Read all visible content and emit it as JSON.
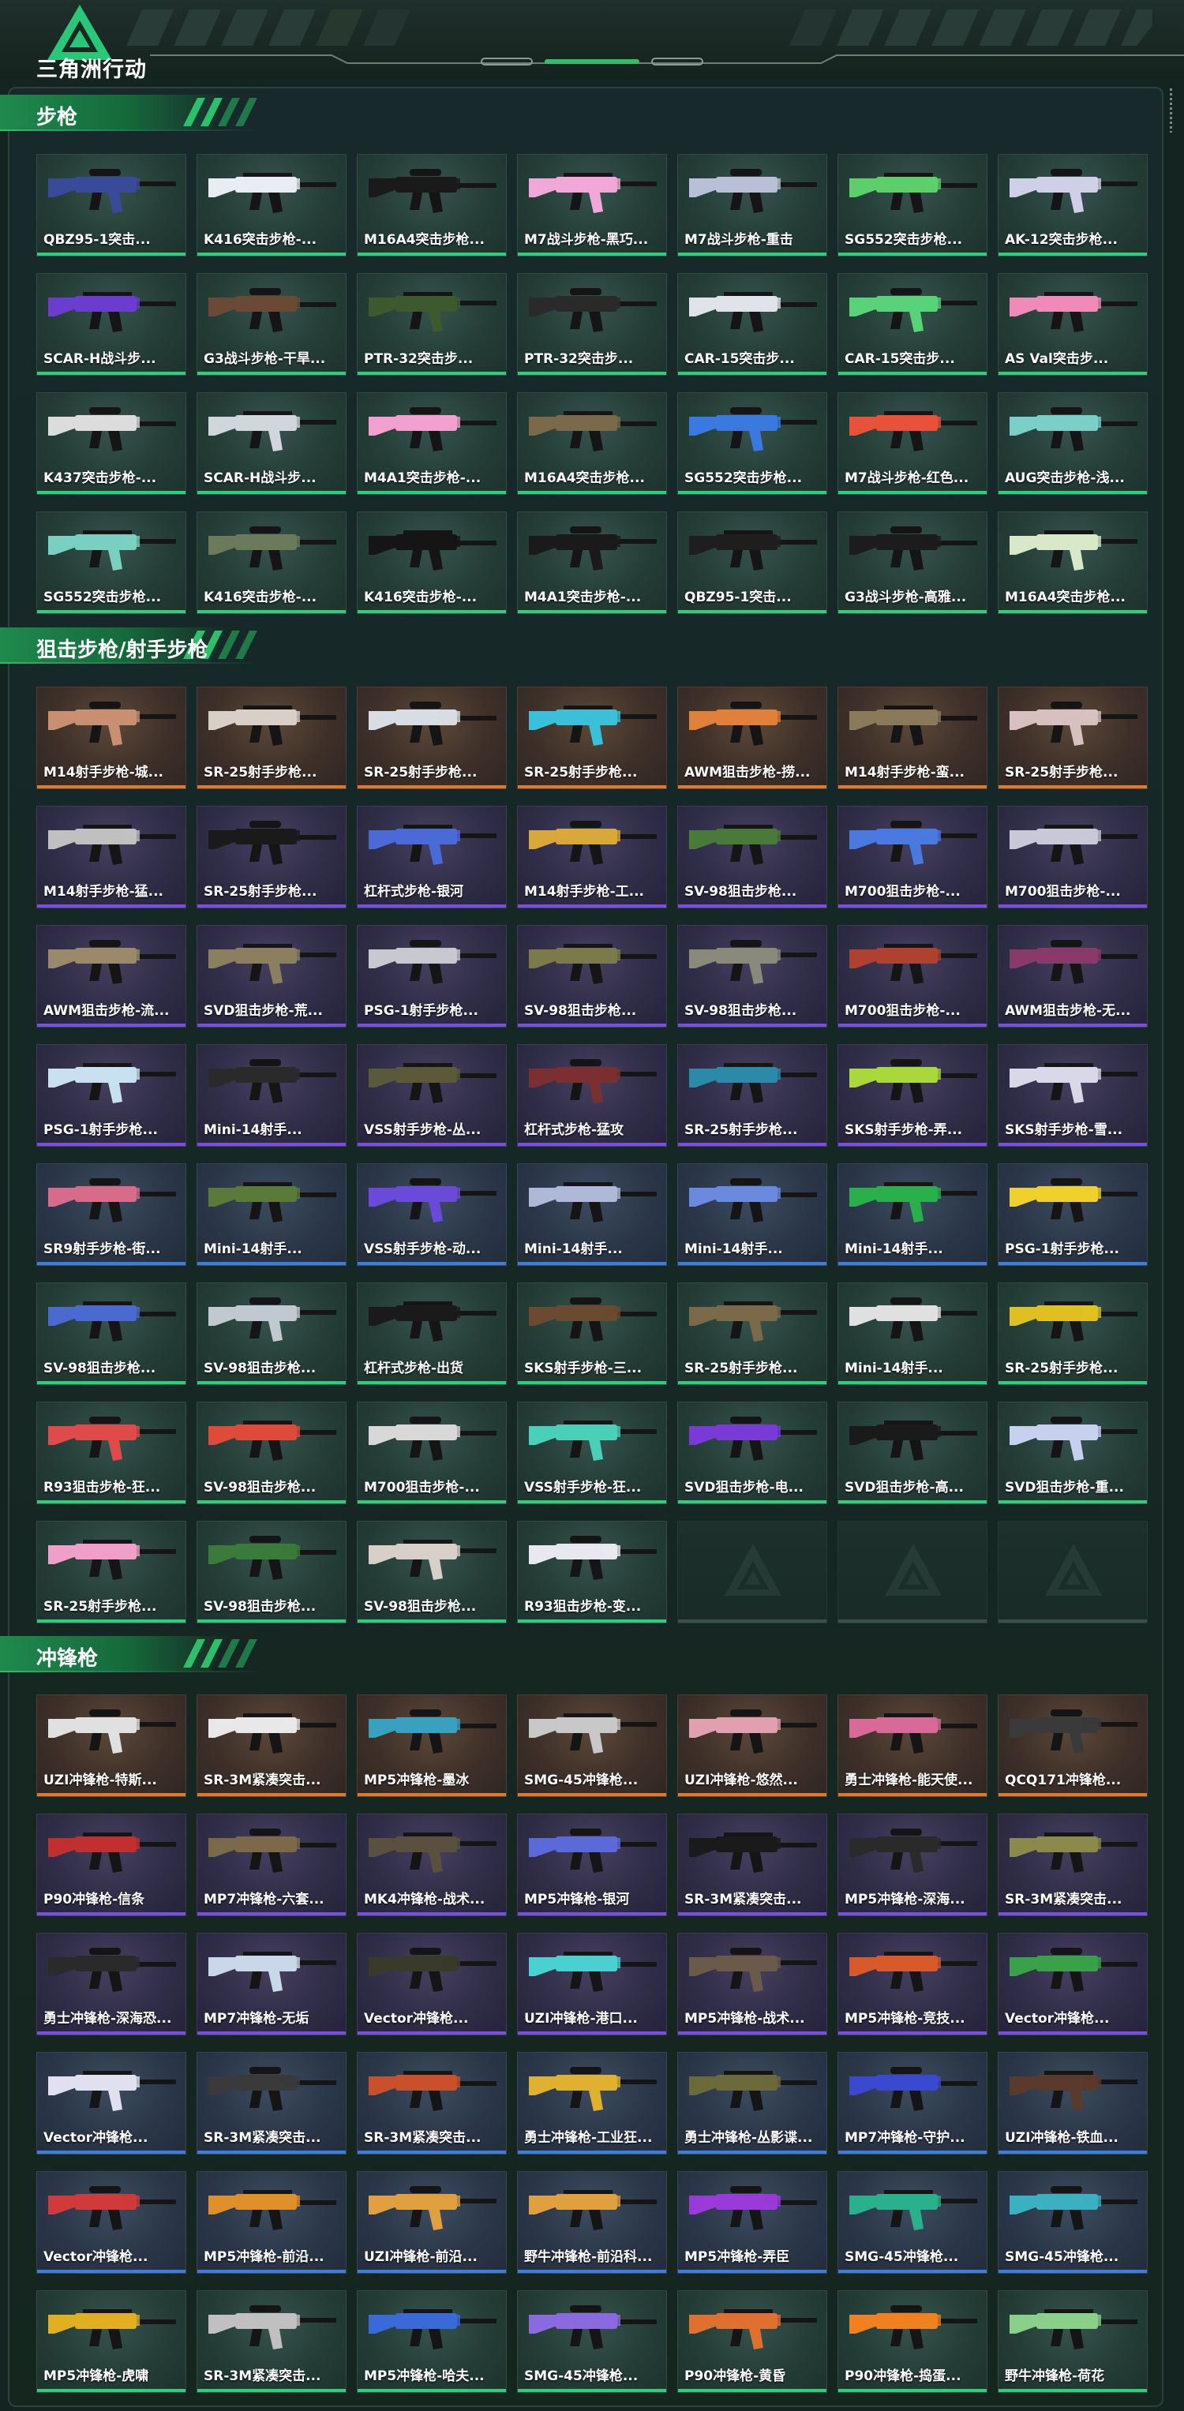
{
  "header": {
    "logo_text": "三角洲行动"
  },
  "sections": [
    {
      "title": "步枪",
      "cards": [
        {
          "label": "QBZ95-1突击...",
          "rarity": "green",
          "gun_color": "#3a4a9a"
        },
        {
          "label": "K416突击步枪-...",
          "rarity": "green",
          "gun_color": "#e8ecf5"
        },
        {
          "label": "M16A4突击步枪...",
          "rarity": "green",
          "gun_color": "#1a1a1a"
        },
        {
          "label": "M7战斗步枪-黑巧...",
          "rarity": "green",
          "gun_color": "#f0a8d8"
        },
        {
          "label": "M7战斗步枪-重击",
          "rarity": "green",
          "gun_color": "#b9bfd6"
        },
        {
          "label": "SG552突击步枪...",
          "rarity": "green",
          "gun_color": "#5ccf6a"
        },
        {
          "label": "AK-12突击步枪...",
          "rarity": "green",
          "gun_color": "#cfcfe8"
        },
        {
          "label": "SCAR-H战斗步...",
          "rarity": "green",
          "gun_color": "#6a3ccf"
        },
        {
          "label": "G3战斗步枪-干旱...",
          "rarity": "green",
          "gun_color": "#6b4a35"
        },
        {
          "label": "PTR-32突击步...",
          "rarity": "green",
          "gun_color": "#3c5a2e"
        },
        {
          "label": "PTR-32突击步...",
          "rarity": "green",
          "gun_color": "#2a2a2a"
        },
        {
          "label": "CAR-15突击步...",
          "rarity": "green",
          "gun_color": "#dfe3ea"
        },
        {
          "label": "CAR-15突击步...",
          "rarity": "green",
          "gun_color": "#58d37a"
        },
        {
          "label": "AS Val突击步...",
          "rarity": "green",
          "gun_color": "#f08ab8"
        },
        {
          "label": "K437突击步枪-...",
          "rarity": "green",
          "gun_color": "#dcdcdc"
        },
        {
          "label": "SCAR-H战斗步...",
          "rarity": "green",
          "gun_color": "#cfd6dc"
        },
        {
          "label": "M4A1突击步枪-...",
          "rarity": "green",
          "gun_color": "#f2a0d0"
        },
        {
          "label": "M16A4突击步枪...",
          "rarity": "green",
          "gun_color": "#7a6a4a"
        },
        {
          "label": "SG552突击步枪...",
          "rarity": "green",
          "gun_color": "#3a7ae0"
        },
        {
          "label": "M7战斗步枪-红色...",
          "rarity": "green",
          "gun_color": "#e8523a"
        },
        {
          "label": "AUG突击步枪-浅...",
          "rarity": "green",
          "gun_color": "#7ad0c8"
        },
        {
          "label": "SG552突击步枪...",
          "rarity": "green",
          "gun_color": "#7ad0c0"
        },
        {
          "label": "K416突击步枪-...",
          "rarity": "green",
          "gun_color": "#6a7a5a"
        },
        {
          "label": "K416突击步枪-...",
          "rarity": "green",
          "gun_color": "#151515"
        },
        {
          "label": "M4A1突击步枪-...",
          "rarity": "green",
          "gun_color": "#1a1a1a"
        },
        {
          "label": "QBZ95-1突击...",
          "rarity": "green",
          "gun_color": "#1e1e1e"
        },
        {
          "label": "G3战斗步枪-高雅...",
          "rarity": "green",
          "gun_color": "#1c1c1c"
        },
        {
          "label": "M16A4突击步枪...",
          "rarity": "green",
          "gun_color": "#d8e8c8"
        }
      ]
    },
    {
      "title": "狙击步枪/射手步枪",
      "cards": [
        {
          "label": "M14射手步枪-城...",
          "rarity": "orange",
          "gun_color": "#c89070"
        },
        {
          "label": "SR-25射手步枪...",
          "rarity": "orange",
          "gun_color": "#d8d0c8"
        },
        {
          "label": "SR-25射手步枪...",
          "rarity": "orange",
          "gun_color": "#d8dde3"
        },
        {
          "label": "SR-25射手步枪...",
          "rarity": "orange",
          "gun_color": "#3ac0d8"
        },
        {
          "label": "AWM狙击步枪-捞...",
          "rarity": "orange",
          "gun_color": "#e0803a"
        },
        {
          "label": "M14射手步枪-蛮...",
          "rarity": "orange",
          "gun_color": "#8a7a5a"
        },
        {
          "label": "SR-25射手步枪...",
          "rarity": "orange",
          "gun_color": "#d8c0c0"
        },
        {
          "label": "M14射手步枪-猛...",
          "rarity": "purple",
          "gun_color": "#c0c0c0"
        },
        {
          "label": "SR-25射手步枪...",
          "rarity": "purple",
          "gun_color": "#1a1a1a"
        },
        {
          "label": "杠杆式步枪-银河",
          "rarity": "purple",
          "gun_color": "#4a6ad8"
        },
        {
          "label": "M14射手步枪-工...",
          "rarity": "purple",
          "gun_color": "#d8a83a"
        },
        {
          "label": "SV-98狙击步枪...",
          "rarity": "purple",
          "gun_color": "#4a7a3a"
        },
        {
          "label": "M700狙击步枪-...",
          "rarity": "purple",
          "gun_color": "#4a7ae0"
        },
        {
          "label": "M700狙击步枪-...",
          "rarity": "purple",
          "gun_color": "#c8c8d8"
        },
        {
          "label": "AWM狙击步枪-流...",
          "rarity": "purple",
          "gun_color": "#9a8a6a"
        },
        {
          "label": "SVD狙击步枪-荒...",
          "rarity": "purple",
          "gun_color": "#8a8060"
        },
        {
          "label": "PSG-1射手步枪...",
          "rarity": "purple",
          "gun_color": "#c8c8d0"
        },
        {
          "label": "SV-98狙击步枪...",
          "rarity": "purple",
          "gun_color": "#7a7a4a"
        },
        {
          "label": "SV-98狙击步枪...",
          "rarity": "purple",
          "gun_color": "#8a8a7a"
        },
        {
          "label": "M700狙击步枪-...",
          "rarity": "purple",
          "gun_color": "#b04030"
        },
        {
          "label": "AWM狙击步枪-无...",
          "rarity": "purple",
          "gun_color": "#8a3a6a"
        },
        {
          "label": "PSG-1射手步枪...",
          "rarity": "purple",
          "gun_color": "#c8e0f0"
        },
        {
          "label": "Mini-14射手...",
          "rarity": "purple",
          "gun_color": "#2a2a2a"
        },
        {
          "label": "VSS射手步枪-丛...",
          "rarity": "purple",
          "gun_color": "#5a5a3a"
        },
        {
          "label": "杠杆式步枪-猛攻",
          "rarity": "purple",
          "gun_color": "#7a3030"
        },
        {
          "label": "SR-25射手步枪...",
          "rarity": "purple",
          "gun_color": "#2a8aa8"
        },
        {
          "label": "SKS射手步枪-弄...",
          "rarity": "purple",
          "gun_color": "#a8d83a"
        },
        {
          "label": "SKS射手步枪-雪...",
          "rarity": "purple",
          "gun_color": "#d8d8e8"
        },
        {
          "label": "SR9射手步枪-街...",
          "rarity": "blue",
          "gun_color": "#d86a8a"
        },
        {
          "label": "Mini-14射手...",
          "rarity": "blue",
          "gun_color": "#5a7a3a"
        },
        {
          "label": "VSS射手步枪-动...",
          "rarity": "blue",
          "gun_color": "#6a4ad8"
        },
        {
          "label": "Mini-14射手...",
          "rarity": "blue",
          "gun_color": "#b0b8d8"
        },
        {
          "label": "Mini-14射手...",
          "rarity": "blue",
          "gun_color": "#6a8ae0"
        },
        {
          "label": "Mini-14射手...",
          "rarity": "blue",
          "gun_color": "#2ab04a"
        },
        {
          "label": "PSG-1射手步枪...",
          "rarity": "blue",
          "gun_color": "#f0d02a"
        },
        {
          "label": "SV-98狙击步枪...",
          "rarity": "green",
          "gun_color": "#4a6ad0"
        },
        {
          "label": "SV-98狙击步枪...",
          "rarity": "green",
          "gun_color": "#c0c8d0"
        },
        {
          "label": "杠杆式步枪-出货",
          "rarity": "green",
          "gun_color": "#1a1a1a"
        },
        {
          "label": "SKS射手步枪-三...",
          "rarity": "green",
          "gun_color": "#6a4a30"
        },
        {
          "label": "SR-25射手步枪...",
          "rarity": "green",
          "gun_color": "#7a6a4a"
        },
        {
          "label": "Mini-14射手...",
          "rarity": "green",
          "gun_color": "#e0e0e0"
        },
        {
          "label": "SR-25射手步枪...",
          "rarity": "green",
          "gun_color": "#e0c020"
        },
        {
          "label": "R93狙击步枪-狂...",
          "rarity": "green",
          "gun_color": "#e04a4a"
        },
        {
          "label": "SV-98狙击步枪...",
          "rarity": "green",
          "gun_color": "#e04a3a"
        },
        {
          "label": "M700狙击步枪-...",
          "rarity": "green",
          "gun_color": "#d8d8d8"
        },
        {
          "label": "VSS射手步枪-狂...",
          "rarity": "green",
          "gun_color": "#4ad0b8"
        },
        {
          "label": "SVD狙击步枪-电...",
          "rarity": "green",
          "gun_color": "#7a3ad8"
        },
        {
          "label": "SVD狙击步枪-高...",
          "rarity": "green",
          "gun_color": "#1a1a1a"
        },
        {
          "label": "SVD狙击步枪-重...",
          "rarity": "green",
          "gun_color": "#c8d0f0"
        },
        {
          "label": "SR-25射手步枪...",
          "rarity": "green",
          "gun_color": "#f0a0c8"
        },
        {
          "label": "SV-98狙击步枪...",
          "rarity": "green",
          "gun_color": "#3a7a3a"
        },
        {
          "label": "SV-98狙击步枪...",
          "rarity": "green",
          "gun_color": "#d8d0c8"
        },
        {
          "label": "R93狙击步枪-变...",
          "rarity": "green",
          "gun_color": "#e8e8f0"
        },
        {
          "label": "",
          "rarity": "empty",
          "gun_color": ""
        },
        {
          "label": "",
          "rarity": "empty",
          "gun_color": ""
        },
        {
          "label": "",
          "rarity": "empty",
          "gun_color": ""
        }
      ]
    },
    {
      "title": "冲锋枪",
      "cards": [
        {
          "label": "UZI冲锋枪-特斯...",
          "rarity": "orange",
          "gun_color": "#e0e0e0"
        },
        {
          "label": "SR-3M紧凑突击...",
          "rarity": "orange",
          "gun_color": "#e8e8e8"
        },
        {
          "label": "MP5冲锋枪-墨冰",
          "rarity": "orange",
          "gun_color": "#3aa0c0"
        },
        {
          "label": "SMG-45冲锋枪...",
          "rarity": "orange",
          "gun_color": "#c8c8c8"
        },
        {
          "label": "UZI冲锋枪-悠然...",
          "rarity": "orange",
          "gun_color": "#e0a0b0"
        },
        {
          "label": "勇士冲锋枪-能天使...",
          "rarity": "orange",
          "gun_color": "#d86a9a"
        },
        {
          "label": "QCQ171冲锋枪...",
          "rarity": "orange",
          "gun_color": "#3a3a3a"
        },
        {
          "label": "P90冲锋枪-信条",
          "rarity": "purple",
          "gun_color": "#c03030"
        },
        {
          "label": "MP7冲锋枪-六套...",
          "rarity": "purple",
          "gun_color": "#7a6a4a"
        },
        {
          "label": "MK4冲锋枪-战术...",
          "rarity": "purple",
          "gun_color": "#5a5040"
        },
        {
          "label": "MP5冲锋枪-银河",
          "rarity": "purple",
          "gun_color": "#5a6ad8"
        },
        {
          "label": "SR-3M紧凑突击...",
          "rarity": "purple",
          "gun_color": "#1a1a1a"
        },
        {
          "label": "MP5冲锋枪-深海...",
          "rarity": "purple",
          "gun_color": "#2a2a2a"
        },
        {
          "label": "SR-3M紧凑突击...",
          "rarity": "purple",
          "gun_color": "#8a8a4a"
        },
        {
          "label": "勇士冲锋枪-深海恐...",
          "rarity": "purple",
          "gun_color": "#2a2a2a"
        },
        {
          "label": "MP7冲锋枪-无垢",
          "rarity": "purple",
          "gun_color": "#c8d8e8"
        },
        {
          "label": "Vector冲锋枪...",
          "rarity": "purple",
          "gun_color": "#3a3a2a"
        },
        {
          "label": "UZI冲锋枪-港口...",
          "rarity": "purple",
          "gun_color": "#4ad0d0"
        },
        {
          "label": "MP5冲锋枪-战术...",
          "rarity": "purple",
          "gun_color": "#6a5a4a"
        },
        {
          "label": "MP5冲锋枪-竞技...",
          "rarity": "purple",
          "gun_color": "#d85a2a"
        },
        {
          "label": "Vector冲锋枪...",
          "rarity": "purple",
          "gun_color": "#3aa04a"
        },
        {
          "label": "Vector冲锋枪...",
          "rarity": "blue",
          "gun_color": "#e0e0f0"
        },
        {
          "label": "SR-3M紧凑突击...",
          "rarity": "blue",
          "gun_color": "#3a3a3a"
        },
        {
          "label": "SR-3M紧凑突击...",
          "rarity": "blue",
          "gun_color": "#c8502a"
        },
        {
          "label": "勇士冲锋枪-工业狂...",
          "rarity": "blue",
          "gun_color": "#e0b030"
        },
        {
          "label": "勇士冲锋枪-丛影谍...",
          "rarity": "blue",
          "gun_color": "#6a6a3a"
        },
        {
          "label": "MP7冲锋枪-守护...",
          "rarity": "blue",
          "gun_color": "#3a4ad0"
        },
        {
          "label": "UZI冲锋枪-铁血...",
          "rarity": "blue",
          "gun_color": "#5a3a2a"
        },
        {
          "label": "Vector冲锋枪...",
          "rarity": "blue",
          "gun_color": "#d03a3a"
        },
        {
          "label": "MP5冲锋枪-前沿...",
          "rarity": "blue",
          "gun_color": "#e0902a"
        },
        {
          "label": "UZI冲锋枪-前沿...",
          "rarity": "blue",
          "gun_color": "#e0a040"
        },
        {
          "label": "野牛冲锋枪-前沿科...",
          "rarity": "blue",
          "gun_color": "#e0a040"
        },
        {
          "label": "MP5冲锋枪-弄臣",
          "rarity": "blue",
          "gun_color": "#9a3ad8"
        },
        {
          "label": "SMG-45冲锋枪...",
          "rarity": "blue",
          "gun_color": "#2ab08a"
        },
        {
          "label": "SMG-45冲锋枪...",
          "rarity": "blue",
          "gun_color": "#3ab0c0"
        },
        {
          "label": "MP5冲锋枪-虎啸",
          "rarity": "green",
          "gun_color": "#e0b020"
        },
        {
          "label": "SR-3M紧凑突击...",
          "rarity": "green",
          "gun_color": "#c0c0c0"
        },
        {
          "label": "MP5冲锋枪-哈夫...",
          "rarity": "green",
          "gun_color": "#3a6ad8"
        },
        {
          "label": "SMG-45冲锋枪...",
          "rarity": "green",
          "gun_color": "#8a6ae0"
        },
        {
          "label": "P90冲锋枪-黄昏",
          "rarity": "green",
          "gun_color": "#e07030"
        },
        {
          "label": "P90冲锋枪-捣蛋...",
          "rarity": "green",
          "gun_color": "#f08020"
        },
        {
          "label": "野牛冲锋枪-荷花",
          "rarity": "green",
          "gun_color": "#8ad08a"
        }
      ]
    }
  ]
}
